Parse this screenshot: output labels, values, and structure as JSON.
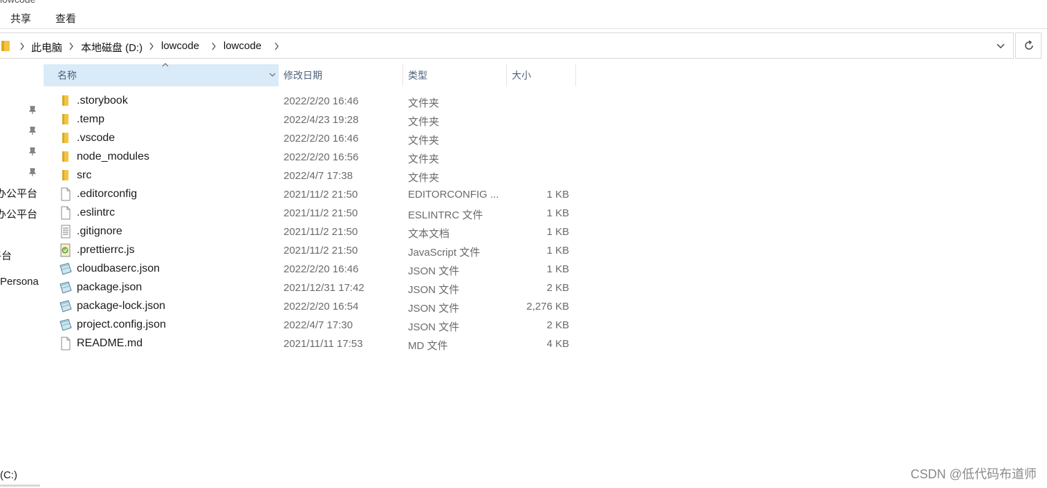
{
  "ribbon": {
    "cut_title": "lowcode",
    "tabs": [
      {
        "label": "共享"
      },
      {
        "label": "查看"
      }
    ]
  },
  "address": {
    "crumbs": [
      {
        "label": "此电脑"
      },
      {
        "label": "本地磁盘 (D:)"
      },
      {
        "label": "lowcode"
      },
      {
        "label": "lowcode"
      }
    ]
  },
  "nav": {
    "items": [
      {
        "label": "办公平台"
      },
      {
        "label": "办公平台"
      },
      {
        "label": "平台"
      },
      {
        "label": "Persona"
      },
      {
        "label": "(C:)"
      }
    ]
  },
  "columns": {
    "name": "名称",
    "modified": "修改日期",
    "type": "类型",
    "size": "大小"
  },
  "files": [
    {
      "name": ".storybook",
      "modified": "2022/2/20 16:46",
      "type": "文件夹",
      "size": "",
      "icon": "folder-icon"
    },
    {
      "name": ".temp",
      "modified": "2022/4/23 19:28",
      "type": "文件夹",
      "size": "",
      "icon": "folder-icon"
    },
    {
      "name": ".vscode",
      "modified": "2022/2/20 16:46",
      "type": "文件夹",
      "size": "",
      "icon": "folder-icon"
    },
    {
      "name": "node_modules",
      "modified": "2022/2/20 16:56",
      "type": "文件夹",
      "size": "",
      "icon": "folder-icon"
    },
    {
      "name": "src",
      "modified": "2022/4/7 17:38",
      "type": "文件夹",
      "size": "",
      "icon": "folder-icon"
    },
    {
      "name": ".editorconfig",
      "modified": "2021/11/2 21:50",
      "type": "EDITORCONFIG ...",
      "size": "1 KB",
      "icon": "blank-file-icon"
    },
    {
      "name": ".eslintrc",
      "modified": "2021/11/2 21:50",
      "type": "ESLINTRC 文件",
      "size": "1 KB",
      "icon": "blank-file-icon"
    },
    {
      "name": ".gitignore",
      "modified": "2021/11/2 21:50",
      "type": "文本文档",
      "size": "1 KB",
      "icon": "text-file-icon"
    },
    {
      "name": ".prettierrc.js",
      "modified": "2021/11/2 21:50",
      "type": "JavaScript 文件",
      "size": "1 KB",
      "icon": "script-file-icon"
    },
    {
      "name": "cloudbaserc.json",
      "modified": "2022/2/20 16:46",
      "type": "JSON 文件",
      "size": "1 KB",
      "icon": "json-file-icon"
    },
    {
      "name": "package.json",
      "modified": "2021/12/31 17:42",
      "type": "JSON 文件",
      "size": "2 KB",
      "icon": "json-file-icon"
    },
    {
      "name": "package-lock.json",
      "modified": "2022/2/20 16:54",
      "type": "JSON 文件",
      "size": "2,276 KB",
      "icon": "json-file-icon"
    },
    {
      "name": "project.config.json",
      "modified": "2022/4/7 17:30",
      "type": "JSON 文件",
      "size": "2 KB",
      "icon": "json-file-icon"
    },
    {
      "name": "README.md",
      "modified": "2021/11/11 17:53",
      "type": "MD 文件",
      "size": "4 KB",
      "icon": "blank-file-icon"
    }
  ],
  "watermark": "CSDN @低代码布道师",
  "colors": {
    "selection": "#d9ebf9",
    "folder": "#f3c440",
    "header_text": "#4c607a"
  }
}
